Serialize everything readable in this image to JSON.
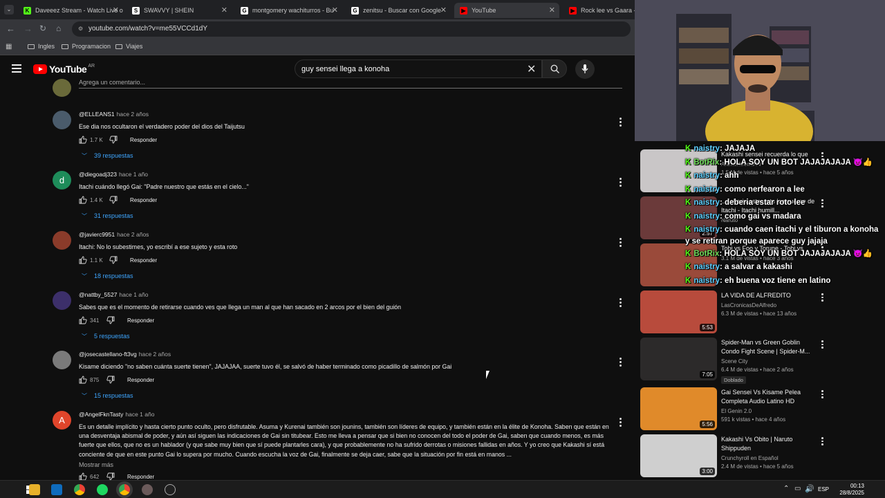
{
  "browser": {
    "tabs": [
      {
        "label": "Daveeez Stream - Watch Live o",
        "fav_color": "#53fc18",
        "fav_letter": "K"
      },
      {
        "label": "SWAVVY | SHEIN",
        "fav_color": "#ffffff",
        "fav_letter": "S"
      },
      {
        "label": "montgomery wachiturros - Bu",
        "fav_color": "#ffffff",
        "fav_letter": "G"
      },
      {
        "label": "zenitsu - Buscar con Google",
        "fav_color": "#ffffff",
        "fav_letter": "G"
      },
      {
        "label": "YouTube",
        "fav_color": "#ff0000",
        "fav_letter": "▶"
      },
      {
        "label": "Rock lee vs Gaara - Lin",
        "fav_color": "#ff0000",
        "fav_letter": "▶"
      }
    ],
    "url": "youtube.com/watch?v=me55VCCd1dY",
    "bookmarks": [
      "Ingles",
      "Programacion",
      "Viajes"
    ]
  },
  "youtube": {
    "logo_text": "YouTube",
    "country_code": "AR",
    "search_value": "guy sensei llega a konoha",
    "add_comment_placeholder": "Agrega un comentario..."
  },
  "comments": [
    {
      "author": "@ELLEANS1",
      "time": "hace 2 años",
      "text": "Ese dia nos ocultaron el verdadero poder del dios del Taijutsu",
      "likes": "1.7 K",
      "reply_label": "Responder",
      "replies": "39 respuestas",
      "avatar_color": "#4a5b6b"
    },
    {
      "author": "@diegoadj323",
      "time": "hace 1 año",
      "text": "Itachi cuándo llegó Gai: \"Padre nuestro que estás en el cielo...\"",
      "likes": "1.4 K",
      "reply_label": "Responder",
      "replies": "31 respuestas",
      "avatar_color": "#1e8c5a",
      "avatar_letter": "d"
    },
    {
      "author": "@javierc9951",
      "time": "hace 2 años",
      "text": "Itachi: No lo subestimes, yo escribí a ese sujeto y esta roto",
      "likes": "1.1 K",
      "reply_label": "Responder",
      "replies": "18 respuestas",
      "avatar_color": "#8a3b2a"
    },
    {
      "author": "@nattby_5527",
      "time": "hace 1 año",
      "text": "Sabes que es el momento de retirarse cuando ves que llega un man al que han sacado en 2 arcos por el bien del guión",
      "likes": "341",
      "reply_label": "Responder",
      "replies": "5 respuestas",
      "avatar_color": "#3c2f6a"
    },
    {
      "author": "@josecastellano-ft3vg",
      "time": "hace 2 años",
      "text": "Kisame diciendo \"no saben cuánta suerte tienen\", JAJAJAA, suerte tuvo él, se salvó de haber terminado como picadillo de salmón por Gai",
      "likes": "875",
      "reply_label": "Responder",
      "replies": "15 respuestas",
      "avatar_color": "#7a7a7a"
    },
    {
      "author": "@AngelFknTasty",
      "time": "hace 1 año",
      "text": "Es un detalle implícito y hasta cierto punto oculto, pero disfrutable. Asuma y Kurenai también son jounins, también son líderes de equipo, y también están en la élite de Konoha. Saben que están en una desventaja abismal de poder, y aún así siguen las indicaciones de Gai sin titubear. Esto me lleva a pensar que si bien no conocen del todo el poder de Gai, saben que cuando menos, es más fuerte que ellos, que no es un hablador (y que sabe muy bien que sí puede plantarles cara), y que probablemente no ha sufrido derrotas o misiones fallidas en años. Y yo creo que Kakashi sí está conciente de que en este punto Gai lo supera por mucho. Cuando escucha la voz de Gai, finalmente se deja caer, sabe que la situación por fin está en manos ...",
      "more": "Mostrar más",
      "likes": "642",
      "reply_label": "Responder",
      "avatar_color": "#e0452b",
      "avatar_letter": "A"
    }
  ],
  "sidebar": [
    {
      "title": "Kakashi sensei recuerda lo que",
      "channel": "AnimeXtremoTV",
      "meta": "1.5 M de vistas • hace 5 años",
      "duration": "",
      "thumb_color": "#c9c6c7"
    },
    {
      "title": "...deberia estar roto lee cuerpo de Itachi - Itachi humill...",
      "channel": "Naruto",
      "meta": "",
      "duration": "2:57",
      "thumb_color": "#6b3a3a"
    },
    {
      "title": "Tobi vs Foo y Torune - Tobi vs",
      "channel": "",
      "meta": "3.1 M de vistas • hace 3 años",
      "duration": "",
      "thumb_color": "#9a4a3a"
    },
    {
      "title": "LA VIDA DE ALFREDITO",
      "channel": "LasCronicasDeAlfredo",
      "meta": "6.3 M de vistas • hace 13 años",
      "duration": "5:53",
      "thumb_color": "#b84b3c"
    },
    {
      "title": "Spider-Man vs Green Goblin Condo Fight Scene | Spider-M...",
      "channel": "Scene City",
      "meta": "6.4 M de vistas • hace 2 años",
      "badge": "Doblado",
      "duration": "7:05",
      "thumb_color": "#2c2a2a"
    },
    {
      "title": "Gai Sensei Vs Kisame Pelea Completa Audio Latino HD",
      "channel": "El Genin 2.0",
      "meta": "591 k vistas • hace 4 años",
      "duration": "5:56",
      "thumb_color": "#e08a2a"
    },
    {
      "title": "Kakashi Vs Obito | Naruto Shippuden",
      "channel": "Crunchyroll en Español",
      "meta": "2.4 M de vistas • hace 5 años",
      "duration": "3:00",
      "thumb_color": "#cfcfcf"
    }
  ],
  "chat": [
    {
      "user": "naistry",
      "text": ": JAJAJA"
    },
    {
      "user": "BotRix",
      "text": ": HOLA SOY UN BOT JAJAJAJAJA 😈👍",
      "bot": true
    },
    {
      "user": "naistry",
      "text": ": ahh"
    },
    {
      "user": "naistry",
      "text": ": como nerfearon a lee"
    },
    {
      "user": "naistry",
      "text": ": deberia estar roto lee"
    },
    {
      "user": "naistry",
      "text": ": como gai vs madara"
    },
    {
      "user": "naistry",
      "text": ": cuando caen itachi y el tiburon a konoha y se retiran porque aparece guy jajaja",
      "wrap": true
    },
    {
      "user": "BotRix",
      "text": ": HOLA SOY UN BOT JAJAJAJAJA 😈👍",
      "bot": true
    },
    {
      "user": "naistry",
      "text": ": a salvar a kakashi"
    },
    {
      "user": "naistry",
      "text": ": eh buena voz tiene en latino"
    }
  ],
  "taskbar": {
    "lang": "ESP",
    "time": "00:13",
    "date": "28/8/2025"
  }
}
